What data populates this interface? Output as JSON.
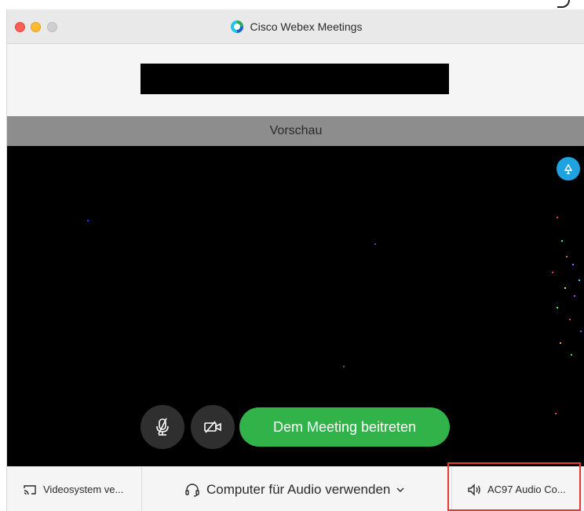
{
  "window": {
    "title": "Cisco Webex Meetings",
    "traffic_lights": [
      "close",
      "minimize",
      "zoom"
    ]
  },
  "preview": {
    "label": "Vorschau"
  },
  "controls": {
    "mute_icon": "microphone-muted-icon",
    "video_icon": "camera-off-icon",
    "join_label": "Dem Meeting beitreten"
  },
  "bottom_bar": {
    "video_system_label": "Videosystem ve...",
    "audio_label": "Computer für Audio verwenden",
    "speaker_label": "AC97 Audio Co..."
  },
  "colors": {
    "join_button": "#31b34a",
    "preview_bar": "#8d8d8d",
    "video_bg": "#000000",
    "badge": "#1fa3e0",
    "highlight": "#e53935"
  }
}
